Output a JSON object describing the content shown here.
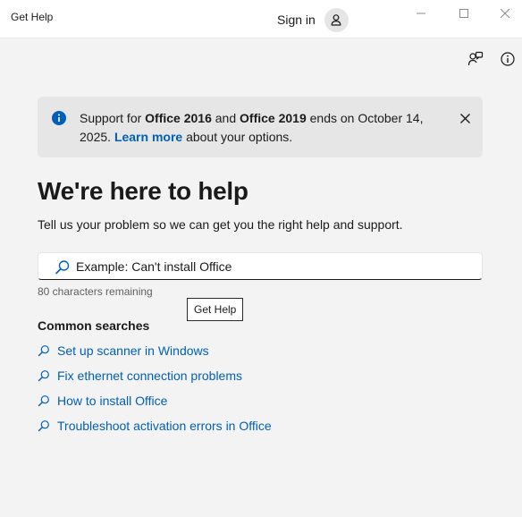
{
  "app": {
    "title": "Get Help"
  },
  "header": {
    "sign_in_label": "Sign in"
  },
  "banner": {
    "prefix": "Support for ",
    "product1": "Office 2016",
    "conjunction": " and ",
    "product2": "Office 2019",
    "suffix": " ends on October 14, 2025.",
    "link_label": "Learn more",
    "after_link": " about your options."
  },
  "main": {
    "heading": "We're here to help",
    "subheading": "Tell us your problem so we can get you the right help and support.",
    "search": {
      "placeholder": "Example: Can't install Office",
      "value": "",
      "chars_remaining": "80 characters remaining"
    },
    "tooltip": "Get Help",
    "common_title": "Common searches",
    "common_searches": [
      {
        "label": "Set up scanner in Windows"
      },
      {
        "label": "Fix ethernet connection problems"
      },
      {
        "label": "How to install Office"
      },
      {
        "label": "Troubleshoot activation errors in Office"
      }
    ]
  },
  "icons": {
    "info": "info-icon",
    "close": "close-icon",
    "search": "search-icon",
    "feedback": "feedback-icon",
    "person": "person-icon"
  },
  "colors": {
    "link": "#005fb8",
    "banner_bg": "#e6e6e6",
    "app_bg": "#f3f3f3",
    "info_icon": "#005fb8"
  }
}
